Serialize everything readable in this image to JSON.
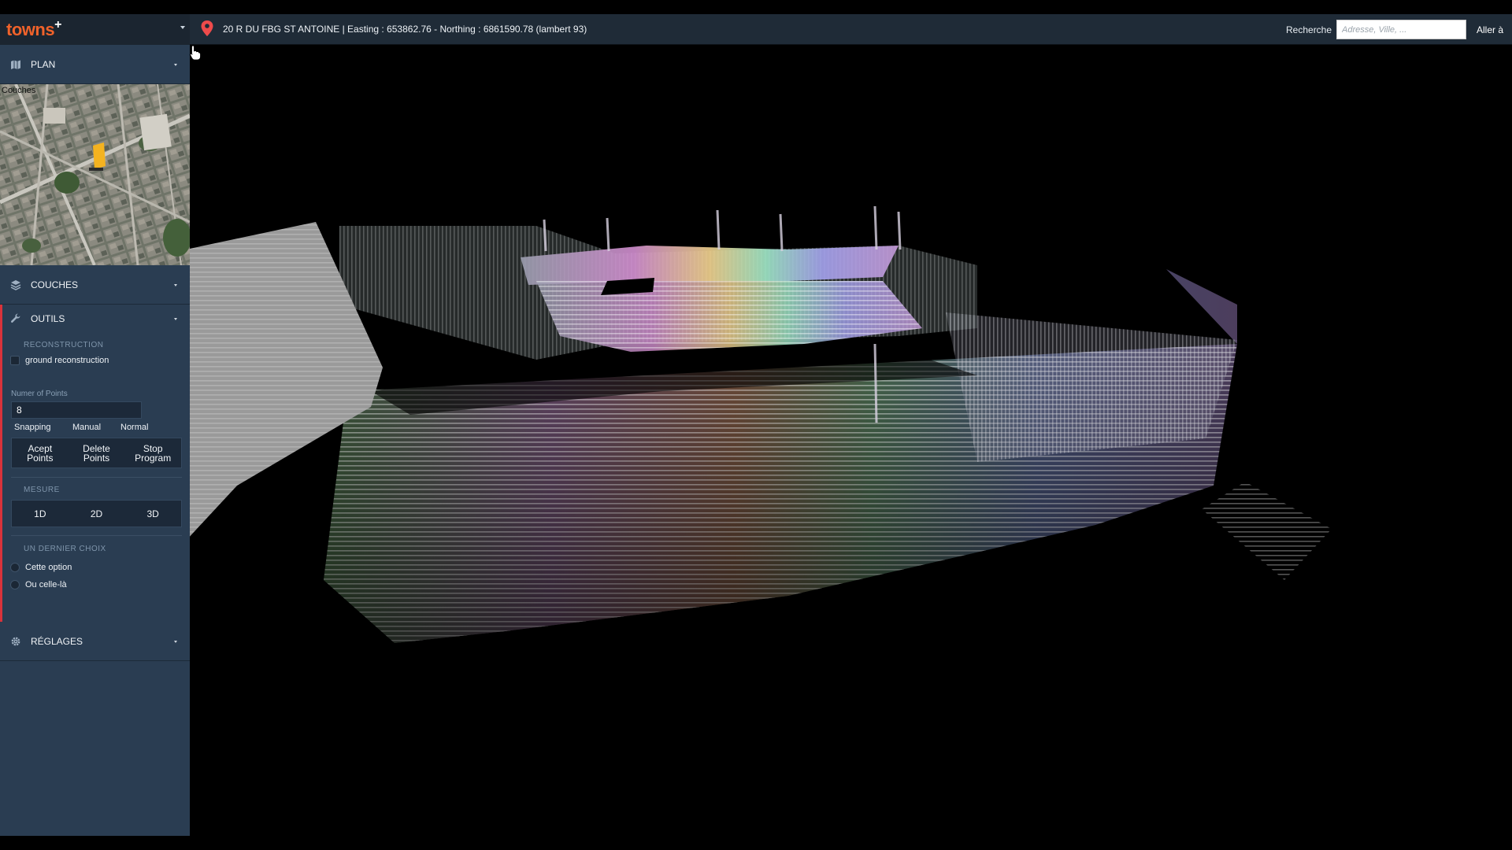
{
  "app": {
    "logo_text": "towns",
    "logo_plus": "+"
  },
  "topbar": {
    "location_icon": "map-pin-icon",
    "address": "20 R DU FBG ST ANTOINE | Easting : 653862.76 - Northing : 6861590.78 (lambert 93)",
    "search_label": "Recherche",
    "search_placeholder": "Adresse, Ville, ...",
    "search_value": "",
    "go_label": "Aller à"
  },
  "sidebar": {
    "sections": [
      {
        "label": "PLAN",
        "icon": "map-icon"
      },
      {
        "label": "COUCHES",
        "icon": "layers-icon"
      },
      {
        "label": "OUTILS",
        "icon": "wrench-icon"
      },
      {
        "label": "RÉGLAGES",
        "icon": "gear-icon"
      }
    ],
    "minimap": {
      "overlay_label": "Couches"
    },
    "outils": {
      "reconstruction_title": "RECONSTRUCTION",
      "ground_label": "ground reconstruction",
      "ground_checked": false,
      "num_points_label": "Numer of Points",
      "num_points_value": "8",
      "snapping": [
        "Snapping",
        "Manual",
        "Normal"
      ],
      "point_buttons": [
        "Acept\nPoints",
        "Delete\nPoints",
        "Stop\nProgram"
      ],
      "mesure_title": "MESURE",
      "mesure_buttons": [
        "1D",
        "2D",
        "3D"
      ],
      "choice_title": "UN DERNIER CHOIX",
      "choice_options": [
        "Cette option",
        "Ou celle-là"
      ]
    }
  },
  "colors": {
    "topbar_bg": "#1f2b37",
    "sidebar_bg": "#2a3d52",
    "accent_red": "#d9333b",
    "brand_orange": "#f0622a"
  }
}
